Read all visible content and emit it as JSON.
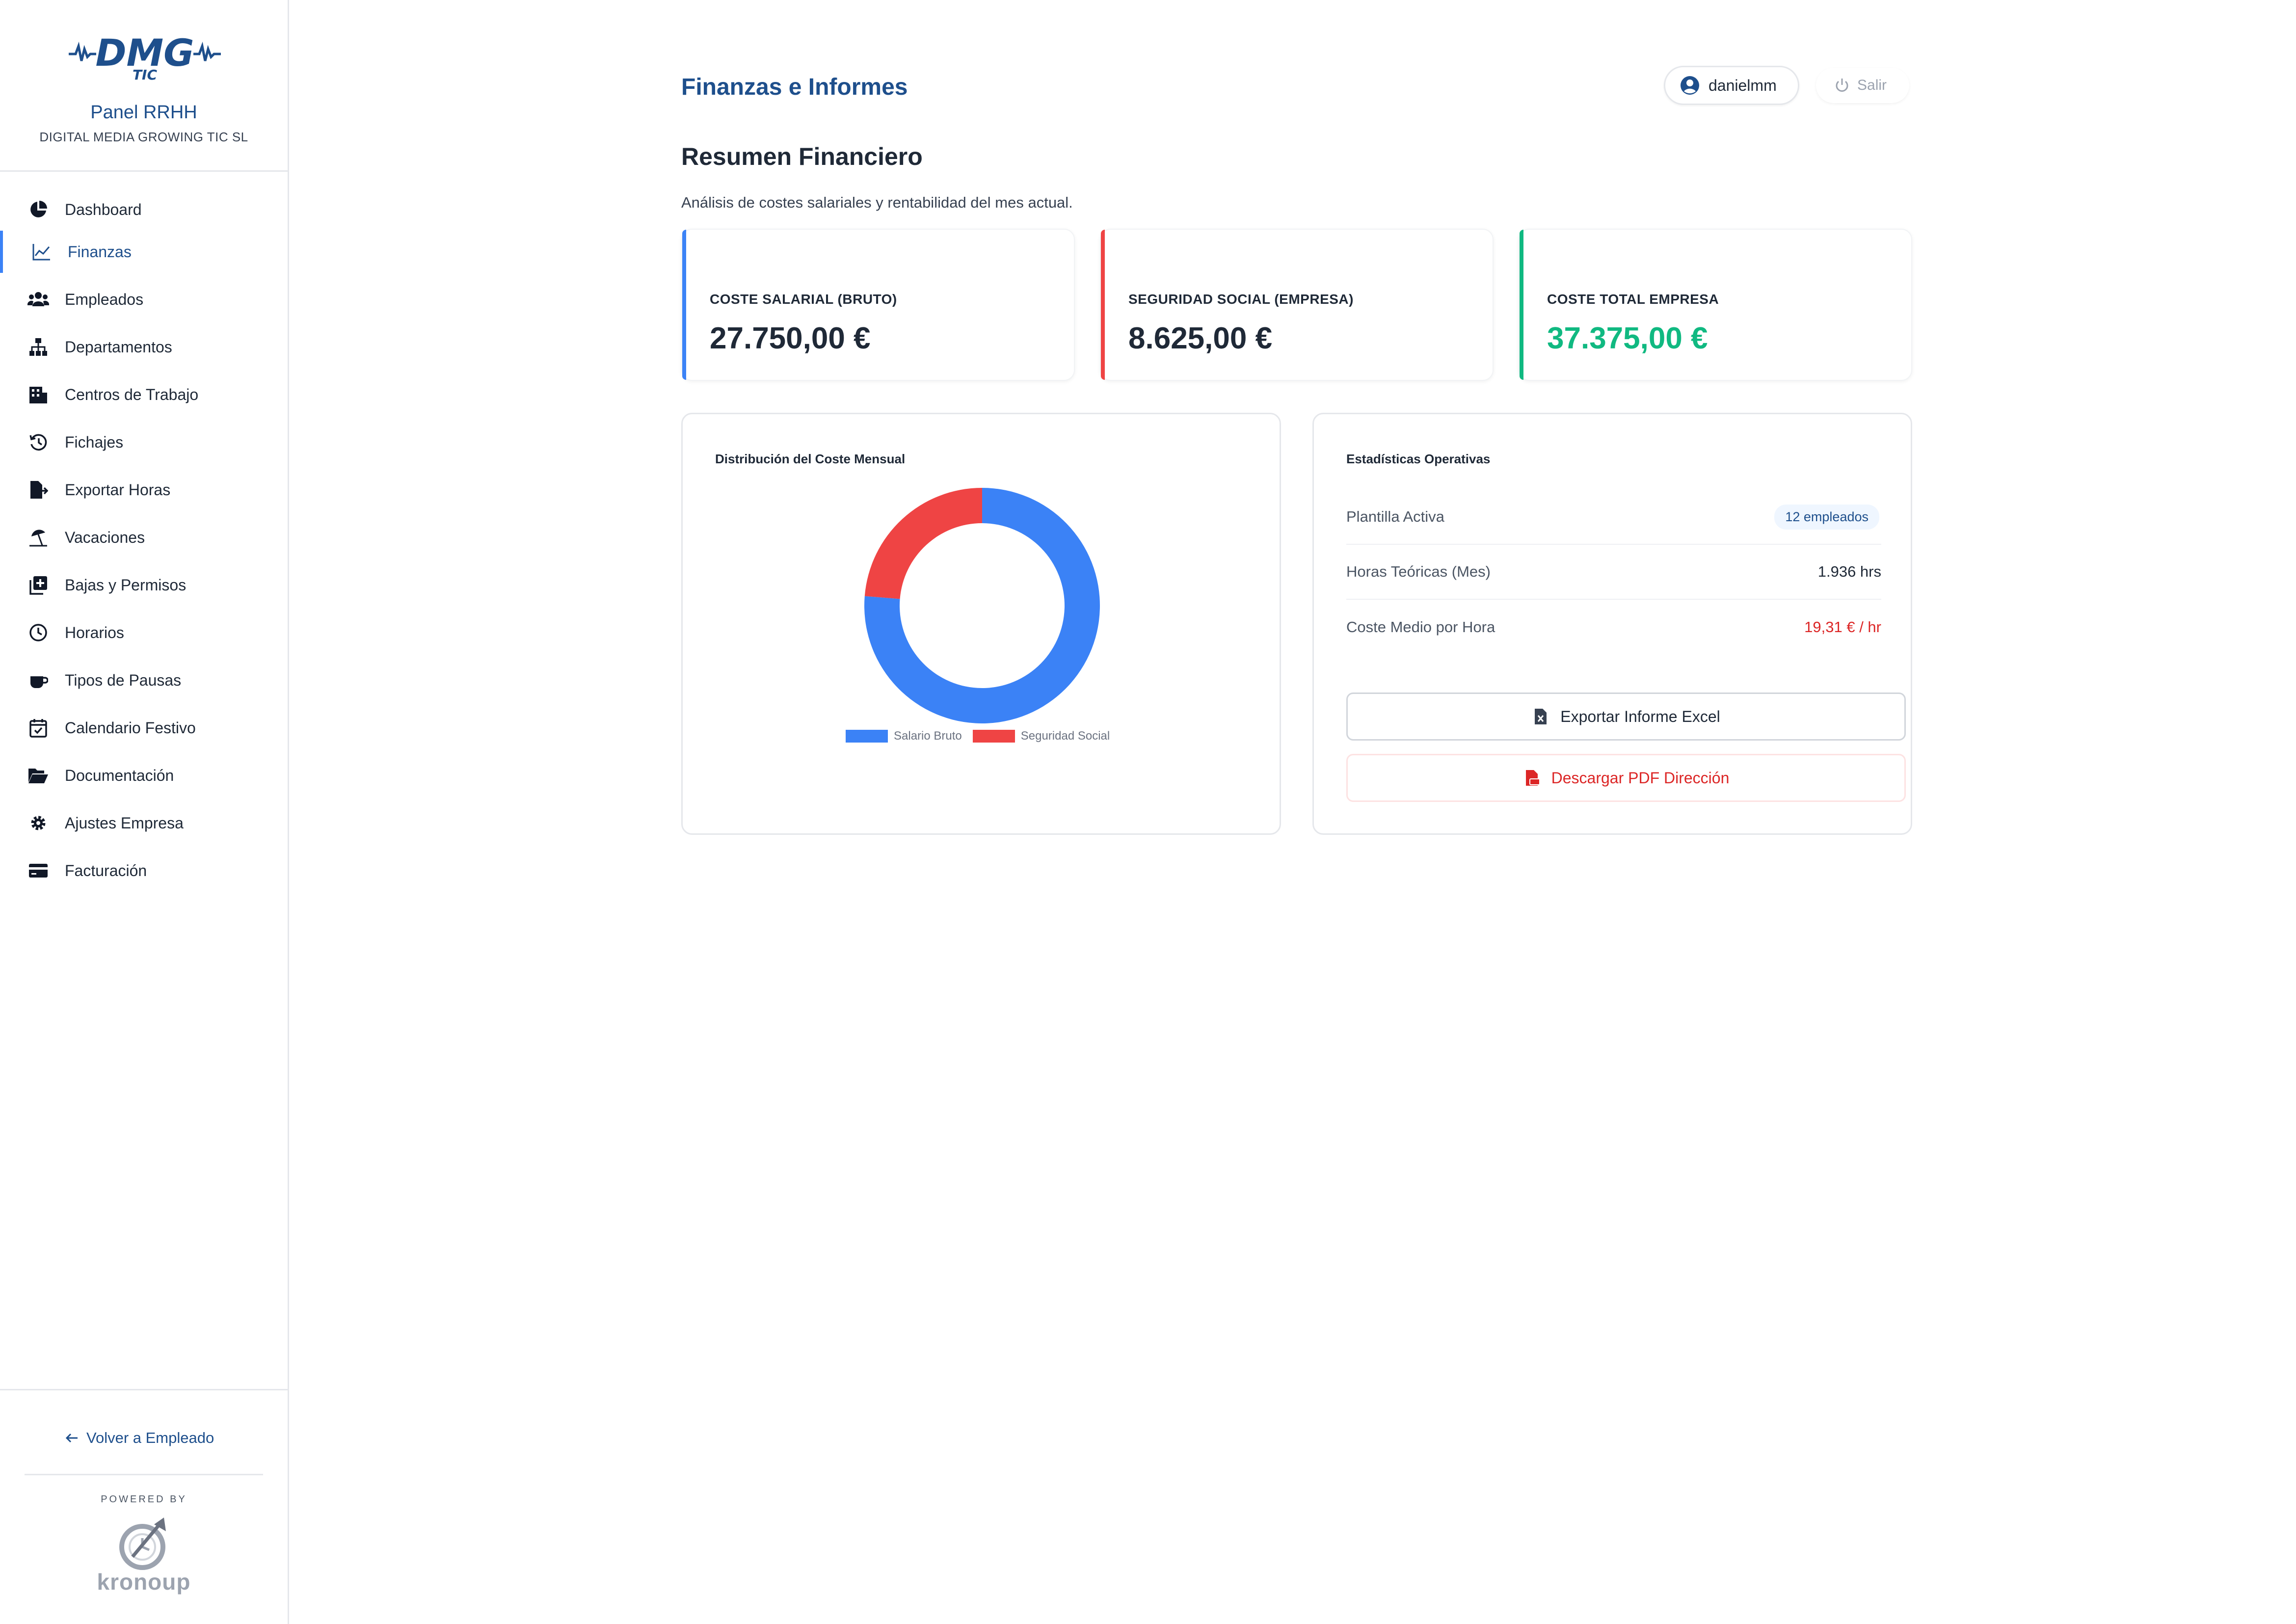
{
  "brand": {
    "logo_text": "DMG",
    "logo_sub": "TIC",
    "panel_title": "Panel RRHH",
    "company": "DIGITAL MEDIA GROWING TIC SL"
  },
  "sidebar": {
    "active": "Finanzas",
    "items": [
      {
        "label": "Dashboard",
        "icon": "chart-pie-icon"
      },
      {
        "label": "Finanzas",
        "icon": "chart-line-icon"
      },
      {
        "label": "Empleados",
        "icon": "users-icon"
      },
      {
        "label": "Departamentos",
        "icon": "sitemap-icon"
      },
      {
        "label": "Centros de Trabajo",
        "icon": "building-icon"
      },
      {
        "label": "Fichajes",
        "icon": "history-icon"
      },
      {
        "label": "Exportar Horas",
        "icon": "file-export-icon"
      },
      {
        "label": "Vacaciones",
        "icon": "umbrella-beach-icon"
      },
      {
        "label": "Bajas y Permisos",
        "icon": "medical-files-icon"
      },
      {
        "label": "Horarios",
        "icon": "clock-icon"
      },
      {
        "label": "Tipos de Pausas",
        "icon": "coffee-icon"
      },
      {
        "label": "Calendario Festivo",
        "icon": "calendar-check-icon"
      },
      {
        "label": "Documentación",
        "icon": "folder-open-icon"
      },
      {
        "label": "Ajustes Empresa",
        "icon": "gear-icon"
      },
      {
        "label": "Facturación",
        "icon": "credit-card-icon"
      }
    ],
    "back_link": "Volver a Empleado",
    "powered_by": "POWERED BY",
    "powered_brand": "kronoup"
  },
  "header": {
    "title": "Finanzas e Informes",
    "username": "danielmm",
    "logout_label": "Salir"
  },
  "summary": {
    "title": "Resumen Financiero",
    "subtitle": "Análisis de costes salariales y rentabilidad del mes actual."
  },
  "kpis": [
    {
      "label": "COSTE SALARIAL (BRUTO)",
      "value": "27.750,00 €",
      "accent": "#3b82f6",
      "value_color": "#1f2937"
    },
    {
      "label": "SEGURIDAD SOCIAL (EMPRESA)",
      "value": "8.625,00 €",
      "accent": "#ef4444",
      "value_color": "#1f2937"
    },
    {
      "label": "COSTE TOTAL EMPRESA",
      "value": "37.375,00 €",
      "accent": "#10b981",
      "value_color": "#10b981"
    }
  ],
  "distribution": {
    "title": "Distribución del Coste Mensual"
  },
  "chart_data": {
    "type": "pie",
    "title": "Distribución del Coste Mensual",
    "categories": [
      "Salario Bruto",
      "Seguridad Social"
    ],
    "values": [
      27750,
      8625
    ],
    "colors": [
      "#3b82f6",
      "#ef4444"
    ],
    "donut": true,
    "legend": "bottom"
  },
  "stats": {
    "title": "Estadísticas Operativas",
    "rows": [
      {
        "label": "Plantilla Activa",
        "value": "12 empleados"
      },
      {
        "label": "Horas Teóricas (Mes)",
        "value": "1.936 hrs"
      },
      {
        "label": "Coste Medio por Hora",
        "value": "19,31 € / hr"
      }
    ],
    "export_excel": "Exportar Informe Excel",
    "download_pdf": "Descargar PDF Dirección"
  }
}
